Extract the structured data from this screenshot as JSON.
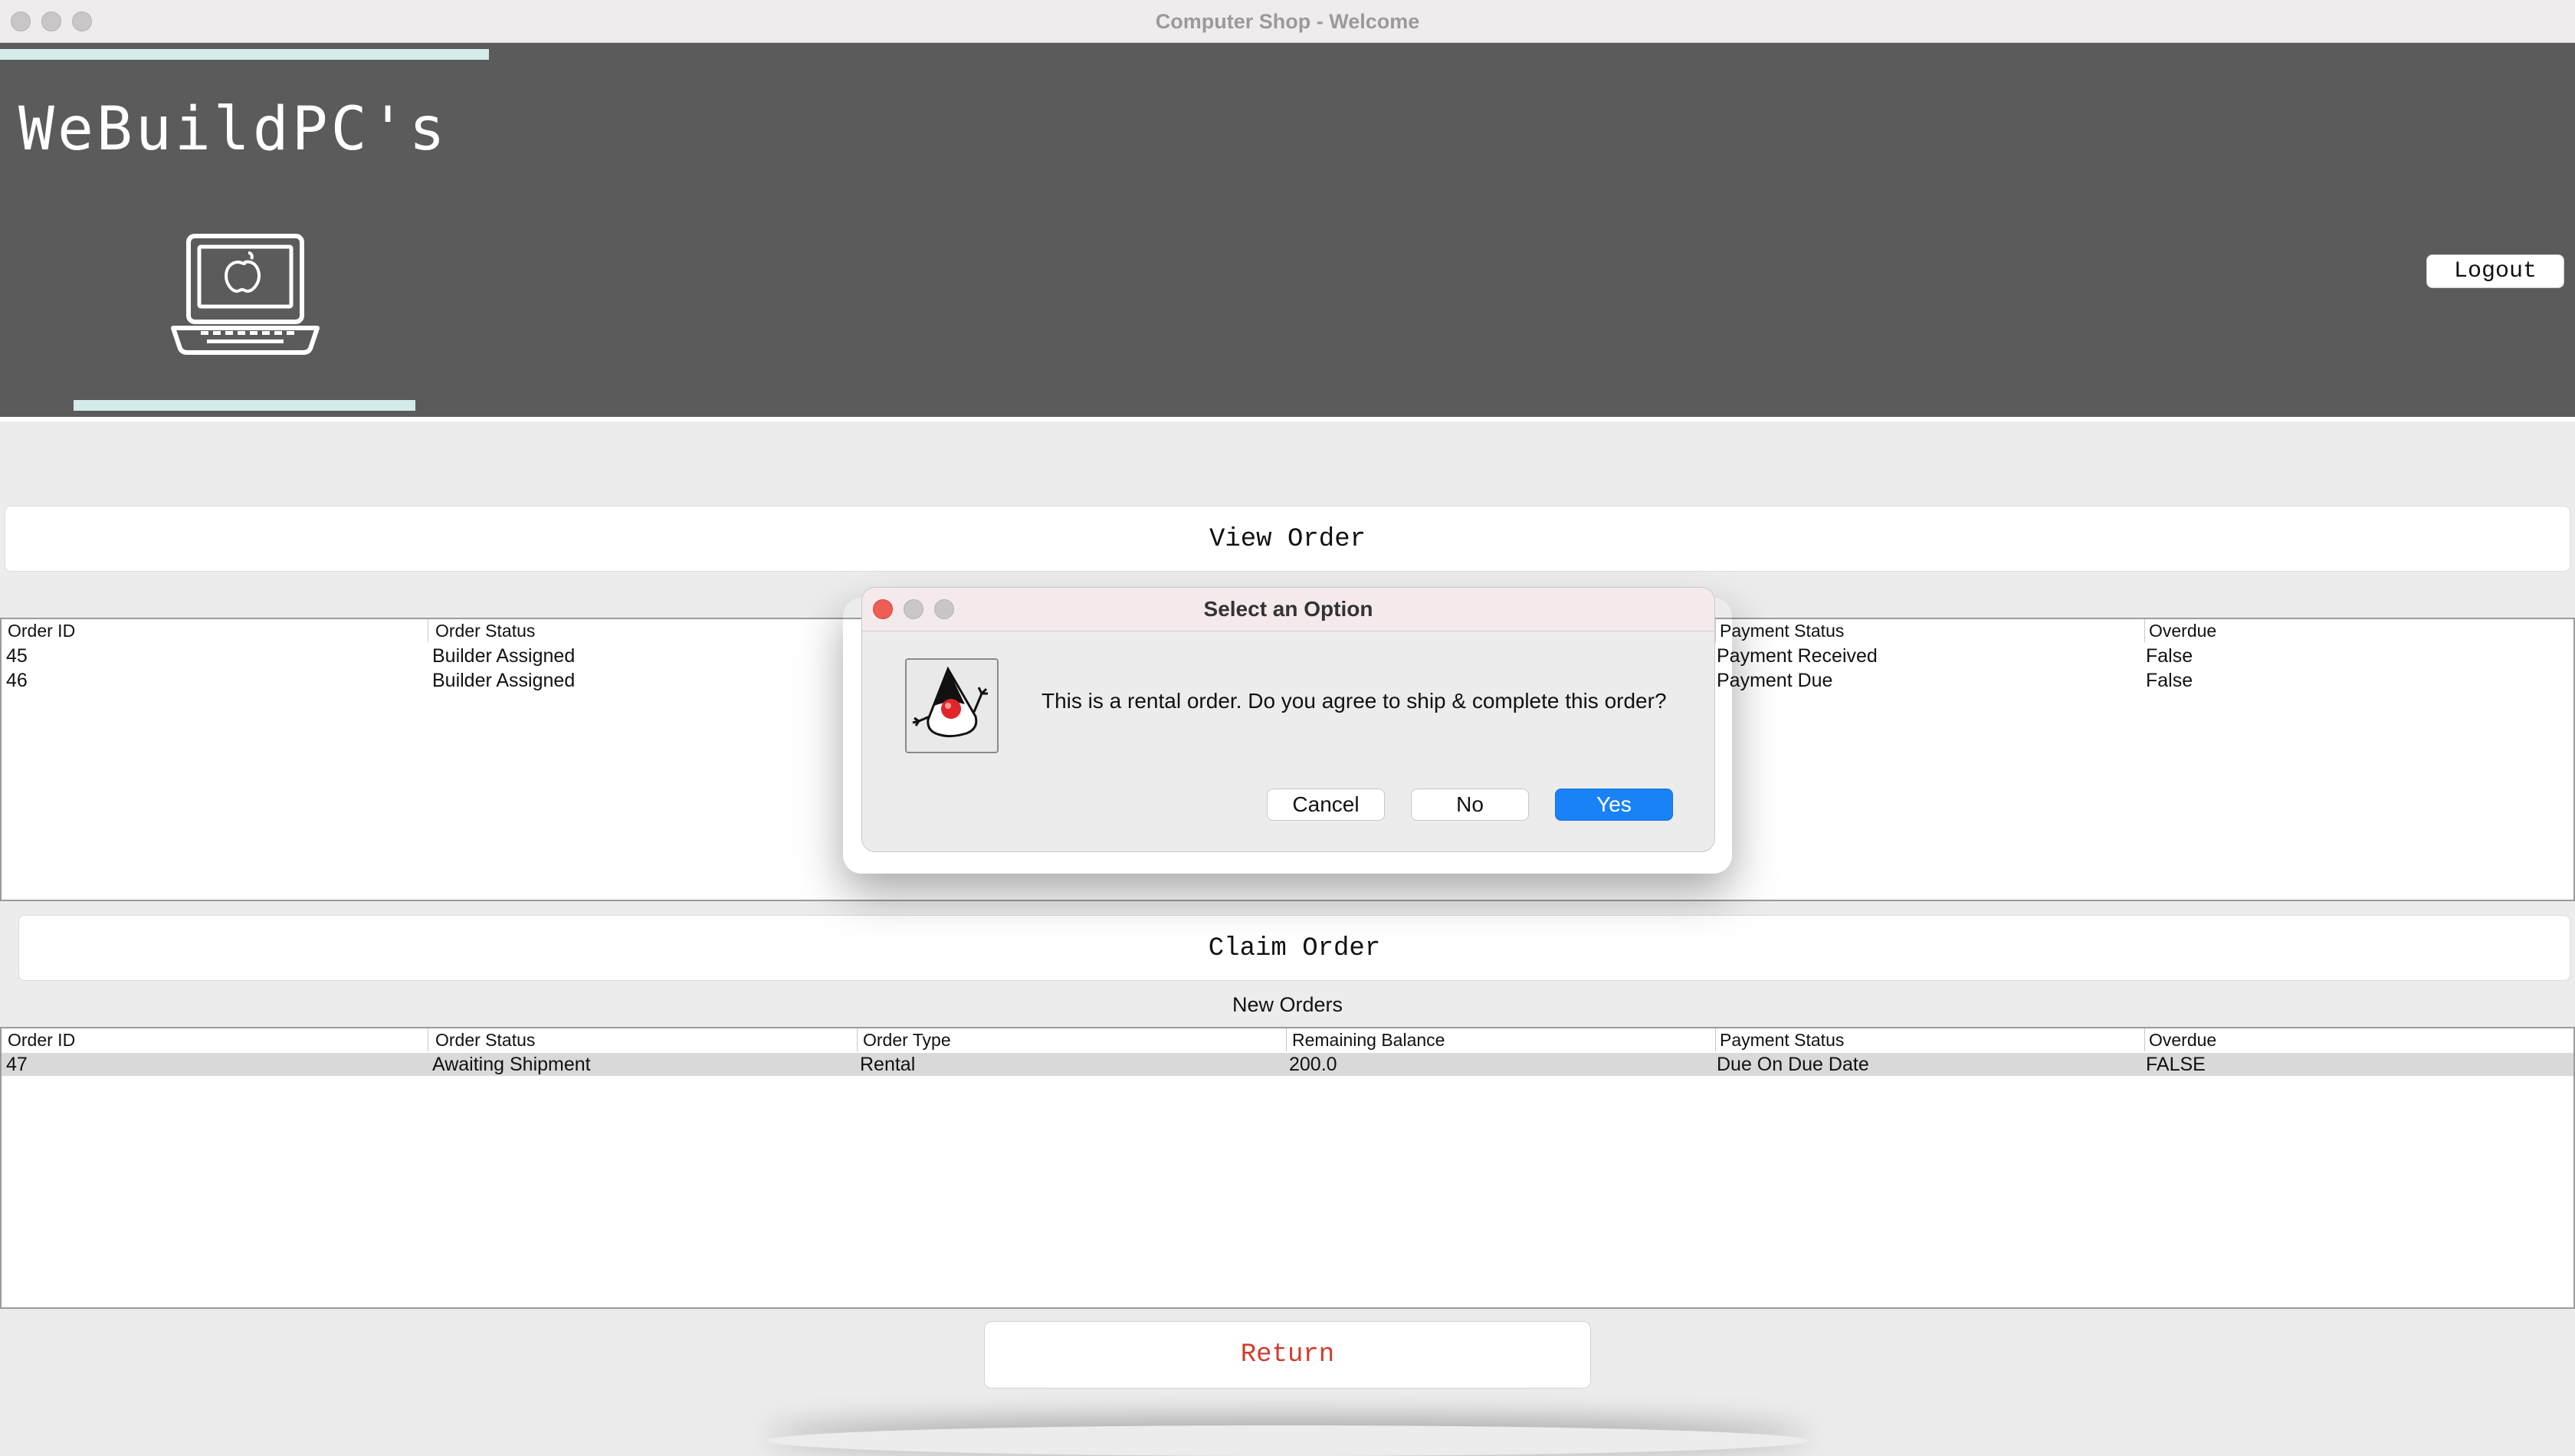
{
  "window": {
    "title": "Computer Shop - Welcome"
  },
  "header": {
    "brand": "WeBuildPC's",
    "logout_label": "Logout"
  },
  "view_order": {
    "button_label": "View Order",
    "columns": [
      "Order ID",
      "Order Status",
      "",
      "",
      "Payment Status",
      "Overdue"
    ],
    "rows": [
      [
        "45",
        "Builder Assigned",
        "",
        "",
        "Payment Received",
        "False"
      ],
      [
        "46",
        "Builder Assigned",
        "",
        "",
        "Payment Due",
        "False"
      ]
    ]
  },
  "claim_order": {
    "button_label": "Claim Order",
    "table_caption": "New Orders",
    "columns": [
      "Order ID",
      "Order Status",
      "Order Type",
      "Remaining Balance",
      "Payment Status",
      "Overdue"
    ],
    "rows": [
      [
        "47",
        "Awaiting Shipment",
        "Rental",
        "200.0",
        "Due On Due Date",
        "FALSE"
      ]
    ]
  },
  "return_label": "Return",
  "dialog": {
    "title": "Select an Option",
    "message": "This is a rental order.  Do you agree to ship & complete this order?",
    "buttons": {
      "cancel": "Cancel",
      "no": "No",
      "yes": "Yes"
    }
  },
  "colors": {
    "header_bg": "#5b5b5b",
    "accent_teal": "#d5ebea",
    "primary_button": "#1a82f7",
    "return_text": "#d23c2c"
  },
  "icons": {
    "logo": "laptop-apple-icon",
    "dialog": "java-duke-icon"
  }
}
